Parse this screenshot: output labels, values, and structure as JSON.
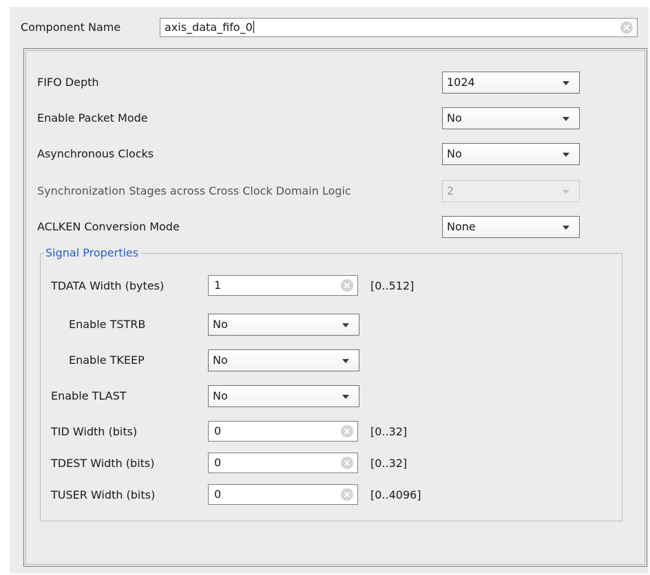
{
  "component": {
    "label": "Component Name",
    "value": "axis_data_fifo_0"
  },
  "settings": {
    "fifo_depth": {
      "label": "FIFO Depth",
      "value": "1024"
    },
    "packet_mode": {
      "label": "Enable Packet Mode",
      "value": "No"
    },
    "async_clocks": {
      "label": "Asynchronous Clocks",
      "value": "No"
    },
    "sync_stages": {
      "label": "Synchronization Stages across Cross Clock Domain Logic",
      "value": "2"
    },
    "aclken_mode": {
      "label": "ACLKEN Conversion Mode",
      "value": "None"
    }
  },
  "signal_properties": {
    "title": "Signal Properties",
    "tdata_width": {
      "label": "TDATA Width (bytes)",
      "value": "1",
      "range": "[0..512]"
    },
    "tstrb": {
      "label": "Enable TSTRB",
      "value": "No"
    },
    "tkeep": {
      "label": "Enable TKEEP",
      "value": "No"
    },
    "tlast": {
      "label": "Enable TLAST",
      "value": "No"
    },
    "tid_width": {
      "label": "TID Width (bits)",
      "value": "0",
      "range": "[0..32]"
    },
    "tdest_width": {
      "label": "TDEST Width (bits)",
      "value": "0",
      "range": "[0..32]"
    },
    "tuser_width": {
      "label": "TUSER Width (bits)",
      "value": "0",
      "range": "[0..4096]"
    }
  }
}
